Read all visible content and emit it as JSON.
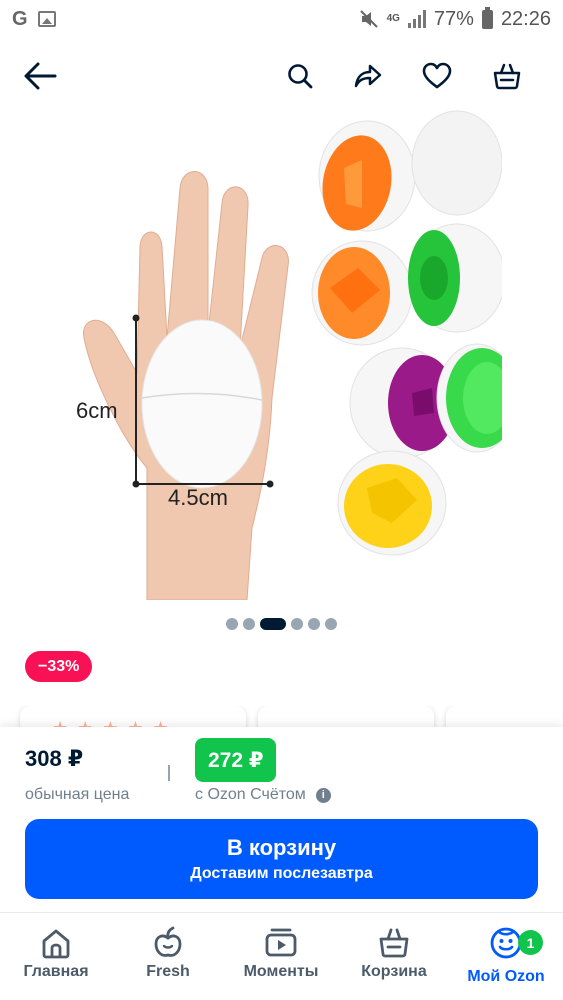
{
  "status_bar": {
    "left_glyph": "G",
    "network": "4G",
    "battery": "77%",
    "time": "22:26"
  },
  "header": {
    "icons": [
      "back-arrow-icon",
      "search-icon",
      "share-icon",
      "heart-icon",
      "basket-icon"
    ]
  },
  "product_image": {
    "height_label": "6cm",
    "width_label": "4.5cm"
  },
  "carousel": {
    "total": 6,
    "active": 3
  },
  "discount": "−33%",
  "price": {
    "regular_value": "308 ₽",
    "regular_label": "обычная цена",
    "ozon_value": "272 ₽",
    "ozon_label": "с Ozon Счётом",
    "info_glyph": "i"
  },
  "cart_button": {
    "title": "В корзину",
    "subtitle": "Доставим послезавтра"
  },
  "bottom_nav": {
    "items": [
      {
        "label": "Главная",
        "icon": "home-icon"
      },
      {
        "label": "Fresh",
        "icon": "fresh-apple-icon"
      },
      {
        "label": "Моменты",
        "icon": "moments-play-icon"
      },
      {
        "label": "Корзина",
        "icon": "cart-basket-icon"
      },
      {
        "label": "Мой Ozon",
        "icon": "profile-face-icon",
        "badge": "1"
      }
    ]
  },
  "colors": {
    "brand_blue": "#005bff",
    "discount_pink": "#f91155",
    "ozon_green": "#10c44c",
    "text_dark": "#001a34"
  }
}
